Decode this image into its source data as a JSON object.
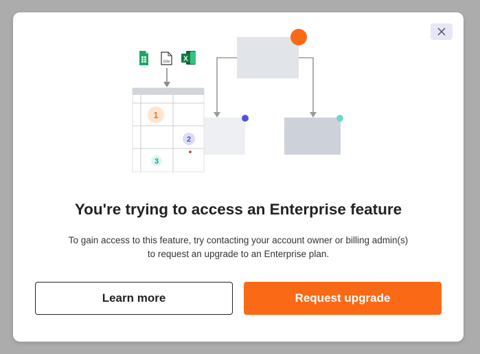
{
  "modal": {
    "title": "You're trying to access an Enterprise feature",
    "description_line1": "To gain access to this feature, try contacting your account owner or billing admin(s)",
    "description_line2": "to request an upgrade to an Enterprise plan.",
    "learn_more_label": "Learn more",
    "request_upgrade_label": "Request upgrade",
    "close_icon": "close-icon"
  },
  "illustration": {
    "file_icons": [
      "google-sheets-icon",
      "csv-file-icon",
      "excel-icon"
    ],
    "csv_label": "csv",
    "excel_label": "X",
    "step_badges": [
      "1",
      "2",
      "3"
    ]
  },
  "colors": {
    "accent": "#fa6a16",
    "overlay": "#acacac",
    "close_bg": "#e6e6f5"
  }
}
